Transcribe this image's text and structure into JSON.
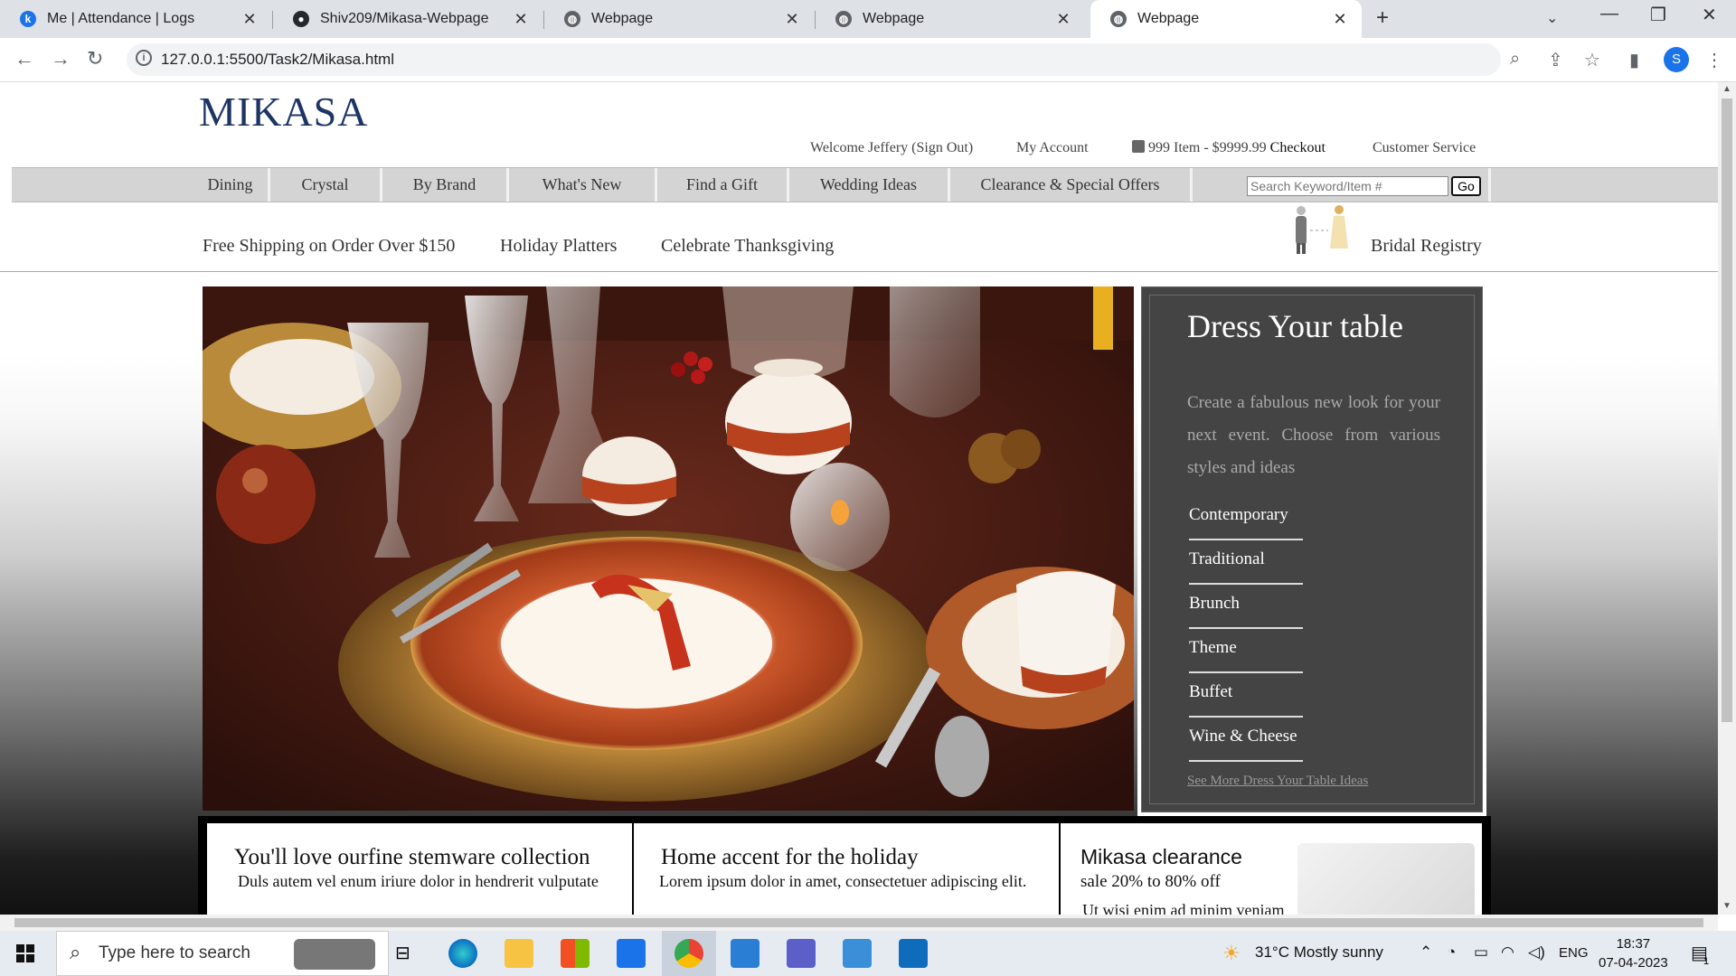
{
  "browser": {
    "tabs": [
      {
        "title": "Me | Attendance | Logs",
        "icon": "k-icon"
      },
      {
        "title": "Shiv209/Mikasa-Webpage",
        "icon": "github-icon"
      },
      {
        "title": "Webpage",
        "icon": "globe-icon"
      },
      {
        "title": "Webpage",
        "icon": "globe-icon"
      },
      {
        "title": "Webpage",
        "icon": "globe-icon",
        "active": true
      }
    ],
    "url": "127.0.0.1:5500/Task2/Mikasa.html",
    "profile_initial": "S"
  },
  "site": {
    "logo": "MIKASA",
    "util": {
      "welcome": "Welcome Jeffery (Sign Out)",
      "account": "My Account",
      "cart": "999 Item - $9999.99",
      "checkout": "Checkout",
      "service": "Customer Service"
    },
    "nav": [
      "Dining",
      "Crystal",
      "By Brand",
      "What's New",
      "Find a Gift",
      "Wedding Ideas",
      "Clearance & Special Offers"
    ],
    "search": {
      "placeholder": "Search Keyword/Item #",
      "button": "Go"
    },
    "subnav": [
      "Free Shipping on Order Over $150",
      "Holiday Platters",
      "Celebrate Thanksgiving"
    ],
    "registry": "Bridal Registry",
    "dress": {
      "title": "Dress Your table",
      "description": "Create a fabulous new look for your next event. Choose from various styles and ideas",
      "styles": [
        "Contemporary",
        "Traditional",
        "Brunch",
        "Theme",
        "Buffet",
        "Wine & Cheese"
      ],
      "more": "See More Dress Your Table Ideas"
    },
    "promos": [
      {
        "title": "You'll love ourfine stemware collection",
        "sub": "Duls autem vel enum iriure dolor in hendrerit vulputate"
      },
      {
        "title": "Home accent for the holiday",
        "sub": "Lorem ipsum dolor in amet, consectetuer adipiscing elit."
      },
      {
        "title": "Mikasa clearance",
        "sub": "sale 20% to 80% off",
        "sub2": "Ut wisi enim ad minim veniam"
      }
    ]
  },
  "taskbar": {
    "search_placeholder": "Type here to search",
    "weather": "31°C  Mostly sunny",
    "lang": "ENG",
    "time": "18:37",
    "date": "07-04-2023",
    "notifications": "1"
  },
  "colors": {
    "logo": "#1d3565",
    "nav_bg": "#d4d4d4",
    "panel_bg": "#444444"
  }
}
